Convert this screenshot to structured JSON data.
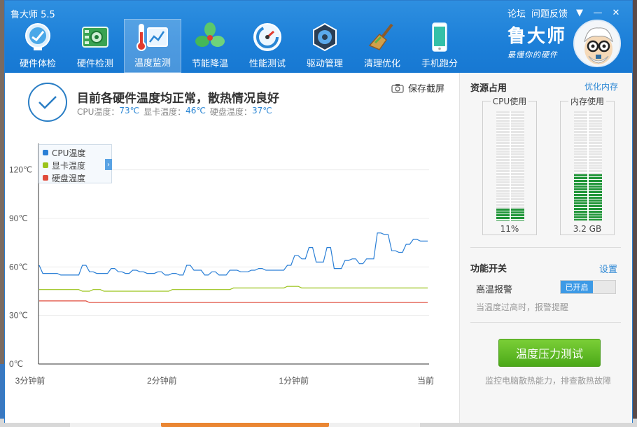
{
  "window": {
    "title": "鲁大师 5.5"
  },
  "title_links": {
    "forum": "论坛",
    "feedback": "问题反馈",
    "menu_icon": "▼",
    "minimize_icon": "—",
    "close_icon": "✕"
  },
  "toolbar": [
    {
      "label": "硬件体检",
      "icon": "monitor-icon",
      "active": false
    },
    {
      "label": "硬件检测",
      "icon": "circuit-board-icon",
      "active": false
    },
    {
      "label": "温度监测",
      "icon": "thermometer-chart-icon",
      "active": true
    },
    {
      "label": "节能降温",
      "icon": "fan-icon",
      "active": false
    },
    {
      "label": "性能测试",
      "icon": "speedometer-icon",
      "active": false
    },
    {
      "label": "驱动管理",
      "icon": "gear-chip-icon",
      "active": false
    },
    {
      "label": "清理优化",
      "icon": "broom-icon",
      "active": false
    },
    {
      "label": "手机跑分",
      "icon": "phone-icon",
      "active": false
    }
  ],
  "brand": {
    "name": "鲁大师",
    "slogan": "最懂你的硬件"
  },
  "status": {
    "title": "目前各硬件温度均正常，散热情况良好",
    "cpu_label": "CPU温度：",
    "cpu_value": "73℃",
    "gpu_label": "显卡温度：",
    "gpu_value": "46℃",
    "disk_label": "硬盘温度：",
    "disk_value": "37℃",
    "save_screenshot": "保存截屏"
  },
  "chart_data": {
    "type": "line",
    "x_labels": [
      "3分钟前",
      "2分钟前",
      "1分钟前",
      "当前"
    ],
    "y_ticks": [
      "0℃",
      "30℃",
      "60℃",
      "90℃",
      "120℃"
    ],
    "ylim": [
      0,
      135
    ],
    "series": [
      {
        "name": "CPU温度",
        "color": "#2a7fd6",
        "values": [
          61,
          56,
          56,
          56,
          56,
          56,
          55,
          55,
          55,
          55,
          55,
          55,
          61,
          61,
          57,
          57,
          56,
          56,
          56,
          56,
          59,
          59,
          57,
          57,
          56,
          56,
          58,
          58,
          57,
          57,
          56,
          56,
          56,
          57,
          57,
          55,
          55,
          56,
          56,
          55,
          55,
          61,
          61,
          58,
          58,
          58,
          55,
          55,
          57,
          57,
          55,
          55,
          55,
          58,
          58,
          58,
          57,
          57,
          57,
          58,
          58,
          59,
          59,
          58,
          58,
          58,
          58,
          58,
          58,
          61,
          61,
          67,
          67,
          65,
          65,
          72,
          72,
          63,
          63,
          63,
          72,
          72,
          59,
          59,
          59,
          64,
          64,
          65,
          65,
          62,
          62,
          65,
          65,
          65,
          81,
          81,
          80,
          80,
          70,
          70,
          69,
          69,
          74,
          74,
          77,
          77,
          76,
          76,
          76
        ]
      },
      {
        "name": "显卡温度",
        "color": "#9bc31b",
        "values": [
          46,
          46,
          46,
          46,
          46,
          46,
          46,
          46,
          46,
          46,
          46,
          46,
          45,
          45,
          45,
          46,
          46,
          46,
          45,
          45,
          45,
          45,
          45,
          45,
          45,
          45,
          45,
          45,
          45,
          45,
          45,
          45,
          45,
          45,
          45,
          45,
          45,
          46,
          46,
          46,
          46,
          46,
          46,
          46,
          46,
          46,
          46,
          46,
          46,
          46,
          46,
          46,
          46,
          46,
          47,
          47,
          47,
          47,
          47,
          47,
          47,
          47,
          47,
          47,
          47,
          47,
          47,
          47,
          47,
          48,
          48,
          48,
          48,
          47,
          47,
          47,
          47,
          47,
          47,
          47,
          47,
          47,
          47,
          47,
          47,
          47,
          47,
          47,
          47,
          47,
          47,
          47,
          47,
          47,
          47,
          47,
          47,
          47,
          47,
          47,
          47,
          47,
          47,
          47,
          47,
          47,
          47,
          47,
          47
        ]
      },
      {
        "name": "硬盘温度",
        "color": "#e04b3b",
        "values": [
          39,
          39,
          39,
          39,
          39,
          39,
          39,
          39,
          39,
          39,
          39,
          39,
          39,
          39,
          38,
          38,
          38,
          38,
          38,
          38,
          38,
          38,
          38,
          38,
          38,
          38,
          38,
          38,
          38,
          38,
          38,
          38,
          38,
          38,
          38,
          38,
          38,
          38,
          38,
          38,
          38,
          38,
          38,
          38,
          38,
          38,
          38,
          38,
          38,
          38,
          38,
          38,
          38,
          38,
          38,
          38,
          38,
          38,
          38,
          38,
          38,
          38,
          38,
          38,
          38,
          38,
          38,
          38,
          38,
          38,
          38,
          38,
          38,
          38,
          38,
          38,
          38,
          38,
          38,
          38,
          38,
          38,
          38,
          38,
          38,
          38,
          38,
          38,
          38,
          38,
          38,
          38,
          38,
          38,
          38,
          38,
          38,
          38,
          38,
          38,
          38,
          38,
          38,
          38,
          38,
          38,
          38,
          38,
          38
        ]
      }
    ]
  },
  "sidebar": {
    "resources_title": "资源占用",
    "optimize_memory": "优化内存",
    "cpu_gauge": {
      "label": "CPU使用",
      "value": "11%",
      "fraction": 0.11
    },
    "mem_gauge": {
      "label": "内存使用",
      "value": "3.2 GB",
      "fraction": 0.42
    },
    "switches_title": "功能开关",
    "settings_link": "设置",
    "alarm_label": "高温报警",
    "alarm_toggle": "已开启",
    "alarm_desc": "当温度过高时，报警提醒",
    "stress_button": "温度压力测试",
    "stress_desc": "监控电脑散热能力，排查散热故障"
  }
}
